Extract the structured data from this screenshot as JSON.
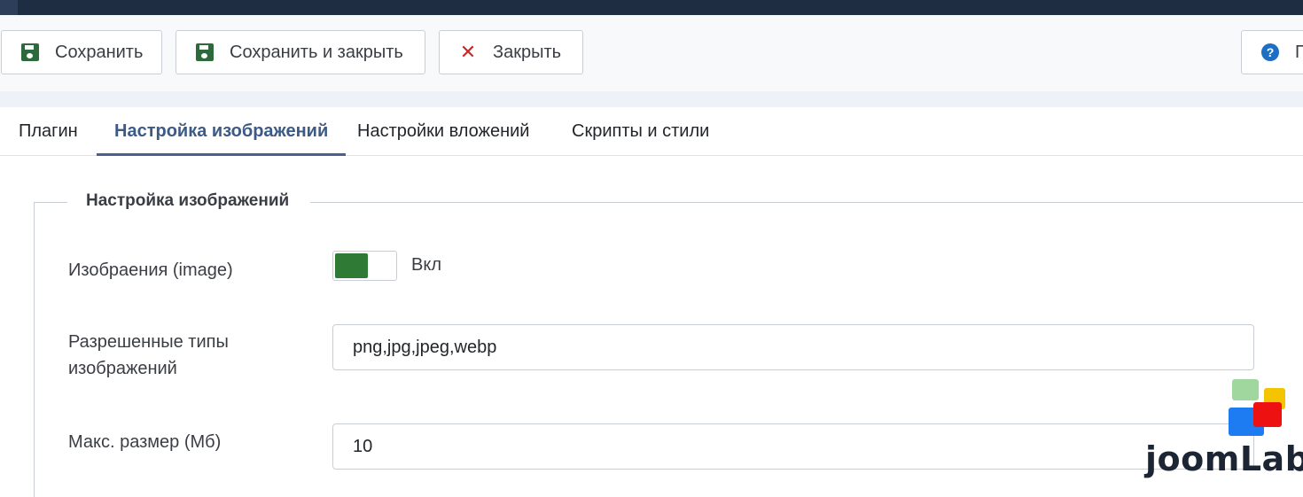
{
  "toolbar": {
    "save_label": "Сохранить",
    "save_close_label": "Сохранить и закрыть",
    "close_label": "Закрыть",
    "help_label": "П"
  },
  "tabs": [
    {
      "label": "Плагин",
      "active": false
    },
    {
      "label": "Настройка изображений",
      "active": true
    },
    {
      "label": "Настройки вложений",
      "active": false
    },
    {
      "label": "Скрипты и стили",
      "active": false
    }
  ],
  "fieldset": {
    "legend": "Настройка изображений",
    "image_toggle": {
      "label": "Изобраения (image)",
      "state_label": "Вкл",
      "enabled": true
    },
    "allowed_types": {
      "label_line1": "Разрешенные типы",
      "label_line2": "изображений",
      "value": "png,jpg,jpeg,webp"
    },
    "max_size": {
      "label": "Макс. размер (Мб)",
      "value": "10"
    }
  },
  "logo": {
    "text": "joomLab",
    "colors": [
      "#9fd79e",
      "#f5c400",
      "#1e7cf2",
      "#ee1111"
    ]
  },
  "colors": {
    "topbar": "#1f2d43",
    "active_tab": "#47628c",
    "toggle_on": "#2f7a35",
    "close_icon": "#c52828",
    "help_icon": "#1d6fc4"
  }
}
